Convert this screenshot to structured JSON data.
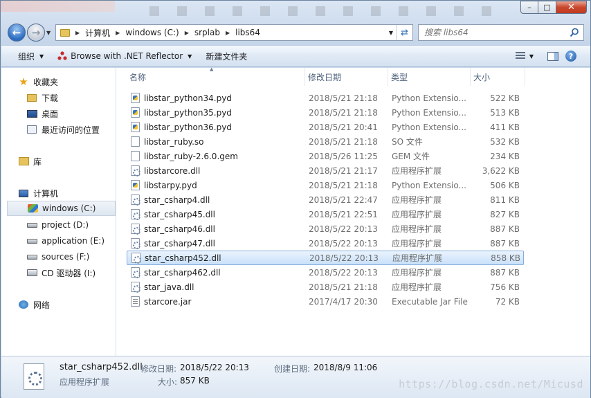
{
  "window": {
    "caption": {
      "minimize": "–",
      "maximize": "□",
      "close": "✕"
    }
  },
  "address": {
    "crumbs": [
      "计算机",
      "windows (C:)",
      "srplab",
      "libs64"
    ],
    "refresh_glyph": "⇄"
  },
  "search": {
    "placeholder": "搜索 libs64"
  },
  "toolbar": {
    "organize": "组织",
    "reflector": "Browse with .NET Reflector",
    "new_folder": "新建文件夹",
    "help": "?"
  },
  "sidebar": {
    "favorites": "收藏夹",
    "downloads": "下载",
    "desktop": "桌面",
    "recent": "最近访问的位置",
    "libraries": "库",
    "computer": "计算机",
    "drives": [
      {
        "label": "windows (C:)"
      },
      {
        "label": "project (D:)"
      },
      {
        "label": "application (E:)"
      },
      {
        "label": "sources (F:)"
      },
      {
        "label": "CD 驱动器 (I:)"
      }
    ],
    "network": "网络"
  },
  "columns": {
    "name": "名称",
    "date": "修改日期",
    "type": "类型",
    "size": "大小"
  },
  "files": [
    {
      "name": "libstar_python34.pyd",
      "date": "2018/5/21 21:18",
      "type": "Python Extensio...",
      "size": "522 KB",
      "icon": "py"
    },
    {
      "name": "libstar_python35.pyd",
      "date": "2018/5/21 21:18",
      "type": "Python Extensio...",
      "size": "513 KB",
      "icon": "py"
    },
    {
      "name": "libstar_python36.pyd",
      "date": "2018/5/21 20:41",
      "type": "Python Extensio...",
      "size": "411 KB",
      "icon": "py"
    },
    {
      "name": "libstar_ruby.so",
      "date": "2018/5/21 21:18",
      "type": "SO 文件",
      "size": "532 KB",
      "icon": "blank"
    },
    {
      "name": "libstar_ruby-2.6.0.gem",
      "date": "2018/5/26 11:25",
      "type": "GEM 文件",
      "size": "234 KB",
      "icon": "blank"
    },
    {
      "name": "libstarcore.dll",
      "date": "2018/5/21 21:17",
      "type": "应用程序扩展",
      "size": "3,622 KB",
      "icon": "dll"
    },
    {
      "name": "libstarpy.pyd",
      "date": "2018/5/21 21:18",
      "type": "Python Extensio...",
      "size": "506 KB",
      "icon": "py"
    },
    {
      "name": "star_csharp4.dll",
      "date": "2018/5/21 22:47",
      "type": "应用程序扩展",
      "size": "811 KB",
      "icon": "dll"
    },
    {
      "name": "star_csharp45.dll",
      "date": "2018/5/21 22:51",
      "type": "应用程序扩展",
      "size": "827 KB",
      "icon": "dll"
    },
    {
      "name": "star_csharp46.dll",
      "date": "2018/5/22 20:13",
      "type": "应用程序扩展",
      "size": "887 KB",
      "icon": "dll"
    },
    {
      "name": "star_csharp47.dll",
      "date": "2018/5/22 20:13",
      "type": "应用程序扩展",
      "size": "887 KB",
      "icon": "dll"
    },
    {
      "name": "star_csharp452.dll",
      "date": "2018/5/22 20:13",
      "type": "应用程序扩展",
      "size": "858 KB",
      "icon": "dll",
      "selected": true
    },
    {
      "name": "star_csharp462.dll",
      "date": "2018/5/22 20:13",
      "type": "应用程序扩展",
      "size": "887 KB",
      "icon": "dll"
    },
    {
      "name": "star_java.dll",
      "date": "2018/5/21 21:18",
      "type": "应用程序扩展",
      "size": "756 KB",
      "icon": "dll"
    },
    {
      "name": "starcore.jar",
      "date": "2017/4/17 20:30",
      "type": "Executable Jar File",
      "size": "72 KB",
      "icon": "jar"
    }
  ],
  "details": {
    "filename": "star_csharp452.dll",
    "modified_label": "修改日期:",
    "modified": "2018/5/22 20:13",
    "created_label": "创建日期:",
    "created": "2018/8/9 11:06",
    "type": "应用程序扩展",
    "size_label": "大小:",
    "size": "857 KB"
  },
  "watermark": "https://blog.csdn.net/Micusd"
}
